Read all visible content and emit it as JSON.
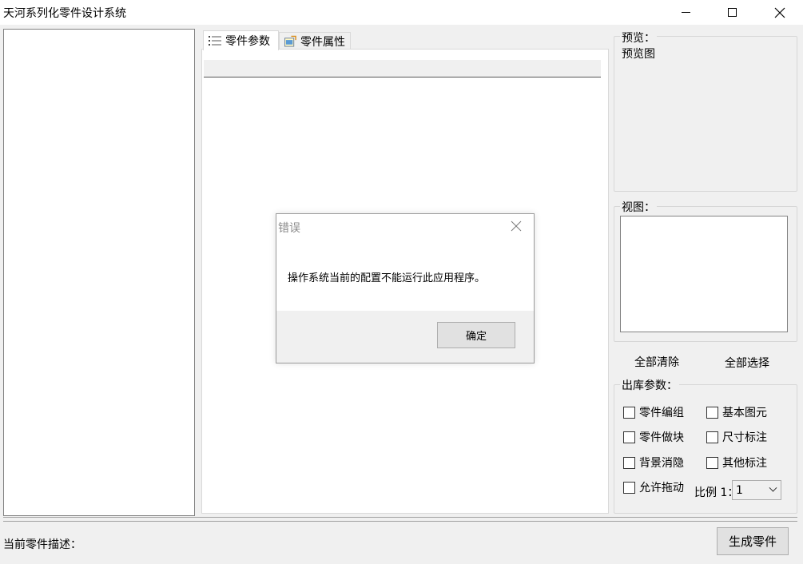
{
  "window": {
    "title": "天河系列化零件设计系统"
  },
  "tabs": [
    {
      "label": "零件参数",
      "icon": "list-icon"
    },
    {
      "label": "零件属性",
      "icon": "properties-icon"
    }
  ],
  "preview": {
    "legend": "预览：",
    "text": "预览图"
  },
  "view": {
    "legend": "视图："
  },
  "buttons": {
    "clear_all": "全部清除",
    "select_all": "全部选择",
    "generate": "生成零件"
  },
  "output_params": {
    "legend": "出库参数：",
    "checkboxes": [
      {
        "label": "零件编组",
        "checked": false
      },
      {
        "label": "基本图元",
        "checked": false
      },
      {
        "label": "零件做块",
        "checked": false
      },
      {
        "label": "尺寸标注",
        "checked": false
      },
      {
        "label": "背景消隐",
        "checked": false
      },
      {
        "label": "其他标注",
        "checked": false
      },
      {
        "label": "允许拖动",
        "checked": false
      }
    ],
    "scale_label": "比例 1：",
    "scale_value": "1"
  },
  "footer": {
    "description_label": "当前零件描述："
  },
  "dialog": {
    "title": "错误",
    "message": "操作系统当前的配置不能运行此应用程序。",
    "ok_label": "确定"
  }
}
